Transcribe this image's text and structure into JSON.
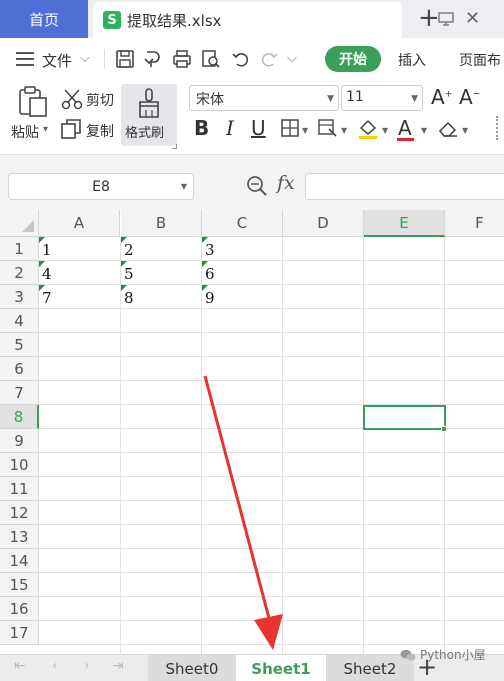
{
  "tabbar": {
    "home_label": "首页",
    "file_tab_name": "提取结果.xlsx",
    "file_logo_letter": "S",
    "close_glyph": "✕",
    "new_tab_glyph": "+"
  },
  "menu": {
    "file_label": "文件",
    "start_label": "开始",
    "insert_label": "插入",
    "layout_label": "页面布"
  },
  "ribbon": {
    "paste_label": "粘贴",
    "cut_label": "剪切",
    "copy_label": "复制",
    "format_painter_label": "格式刷",
    "font_name": "宋体",
    "font_size": "11",
    "bold": "B",
    "italic": "I",
    "underline": "U",
    "grow_font": "A",
    "shrink_font": "A",
    "font_color_glyph": "A"
  },
  "formula_bar": {
    "name_box_value": "E8",
    "fx_label": "fx",
    "formula_value": ""
  },
  "grid": {
    "columns": [
      "A",
      "B",
      "C",
      "D",
      "E",
      "F"
    ],
    "selected_column": "E",
    "rows": [
      "1",
      "2",
      "3",
      "4",
      "5",
      "6",
      "7",
      "8",
      "9",
      "10",
      "11",
      "12",
      "13",
      "14",
      "15",
      "16",
      "17"
    ],
    "selected_row": "8",
    "active_cell": "E8",
    "cells": [
      {
        "ref": "A1",
        "value": "1"
      },
      {
        "ref": "B1",
        "value": "2"
      },
      {
        "ref": "C1",
        "value": "3"
      },
      {
        "ref": "A2",
        "value": "4"
      },
      {
        "ref": "B2",
        "value": "5"
      },
      {
        "ref": "C2",
        "value": "6"
      },
      {
        "ref": "A3",
        "value": "7"
      },
      {
        "ref": "B3",
        "value": "8"
      },
      {
        "ref": "C3",
        "value": "9"
      }
    ],
    "text_number_indicator_color": "#2e8b3a"
  },
  "sheets": {
    "tabs": [
      "Sheet0",
      "Sheet1",
      "Sheet2"
    ],
    "active": "Sheet1",
    "add_glyph": "+"
  },
  "watermark": {
    "text": "Python小屋"
  },
  "colors": {
    "accent_green": "#3a9f58",
    "home_tab_blue": "#4f6fd6",
    "annotation_red": "#e8332e"
  }
}
